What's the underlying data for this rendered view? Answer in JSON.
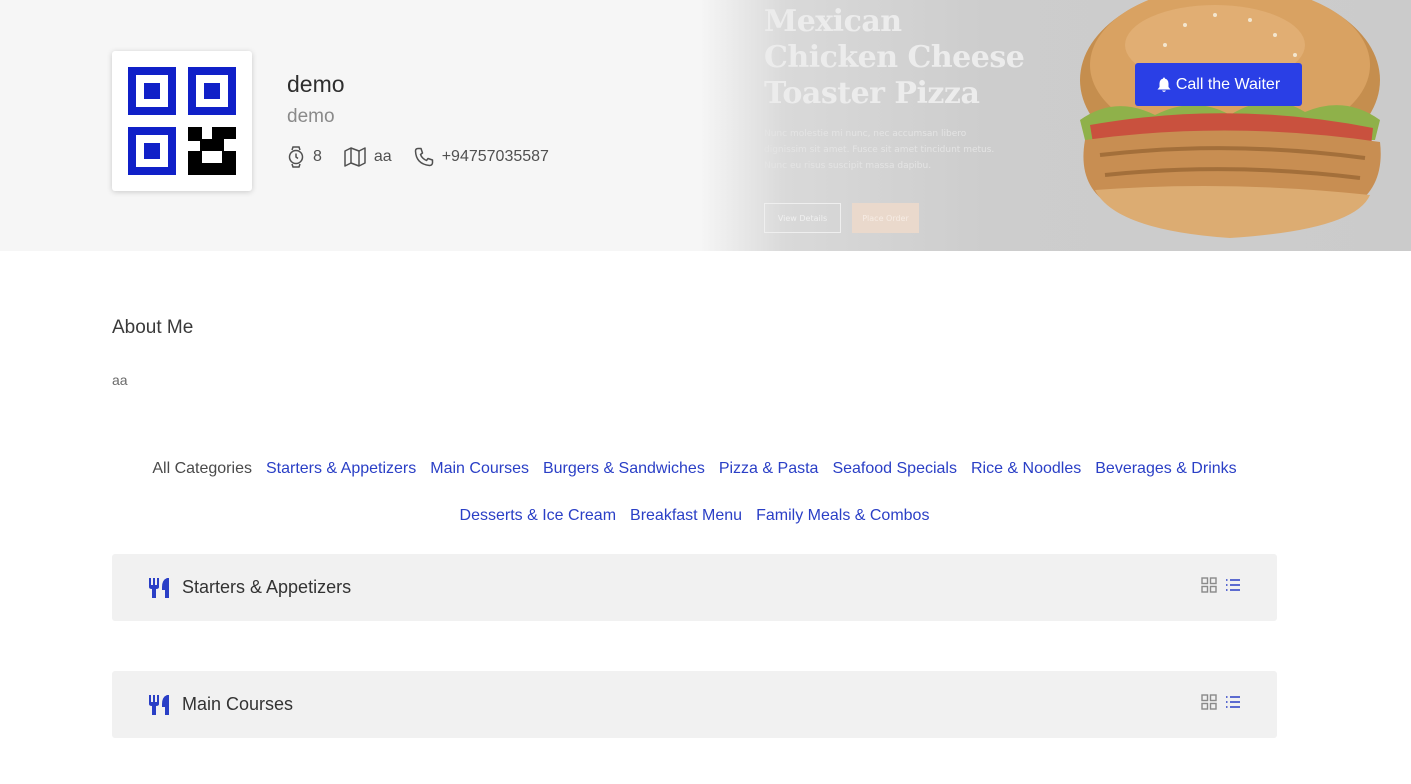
{
  "banner": {
    "title_lines": [
      "Mexican",
      "Chicken Cheese",
      "Toaster Pizza"
    ],
    "text": "Nunc molestie mi nunc, nec accumsan libero dignissim sit amet. Fusce sit amet tincidunt metus. Nunc eu risus suscipit massa dapibu.",
    "view_details": "View Details",
    "order": "Place Order"
  },
  "profile": {
    "name": "demo",
    "subtitle": "demo",
    "watch_value": "8",
    "map_value": "aa",
    "phone": "+94757035587"
  },
  "actions": {
    "call_waiter": "Call the Waiter"
  },
  "about": {
    "title": "About Me",
    "text": "aa"
  },
  "categories": [
    "All Categories",
    "Starters & Appetizers",
    "Main Courses",
    "Burgers & Sandwiches",
    "Pizza & Pasta",
    "Seafood Specials",
    "Rice & Noodles",
    "Beverages & Drinks",
    "Desserts & Ice Cream",
    "Breakfast Menu",
    "Family Meals & Combos"
  ],
  "sections": [
    {
      "title": "Starters & Appetizers"
    },
    {
      "title": "Main Courses"
    }
  ],
  "colors": {
    "accent": "#2a3fe6",
    "link": "#2a3fc6",
    "qr": "#1020c8"
  },
  "icons": [
    "qr-code-icon",
    "watch-icon",
    "map-icon",
    "phone-icon",
    "bell-icon",
    "utensils-icon",
    "grid-view-icon",
    "list-view-icon"
  ]
}
